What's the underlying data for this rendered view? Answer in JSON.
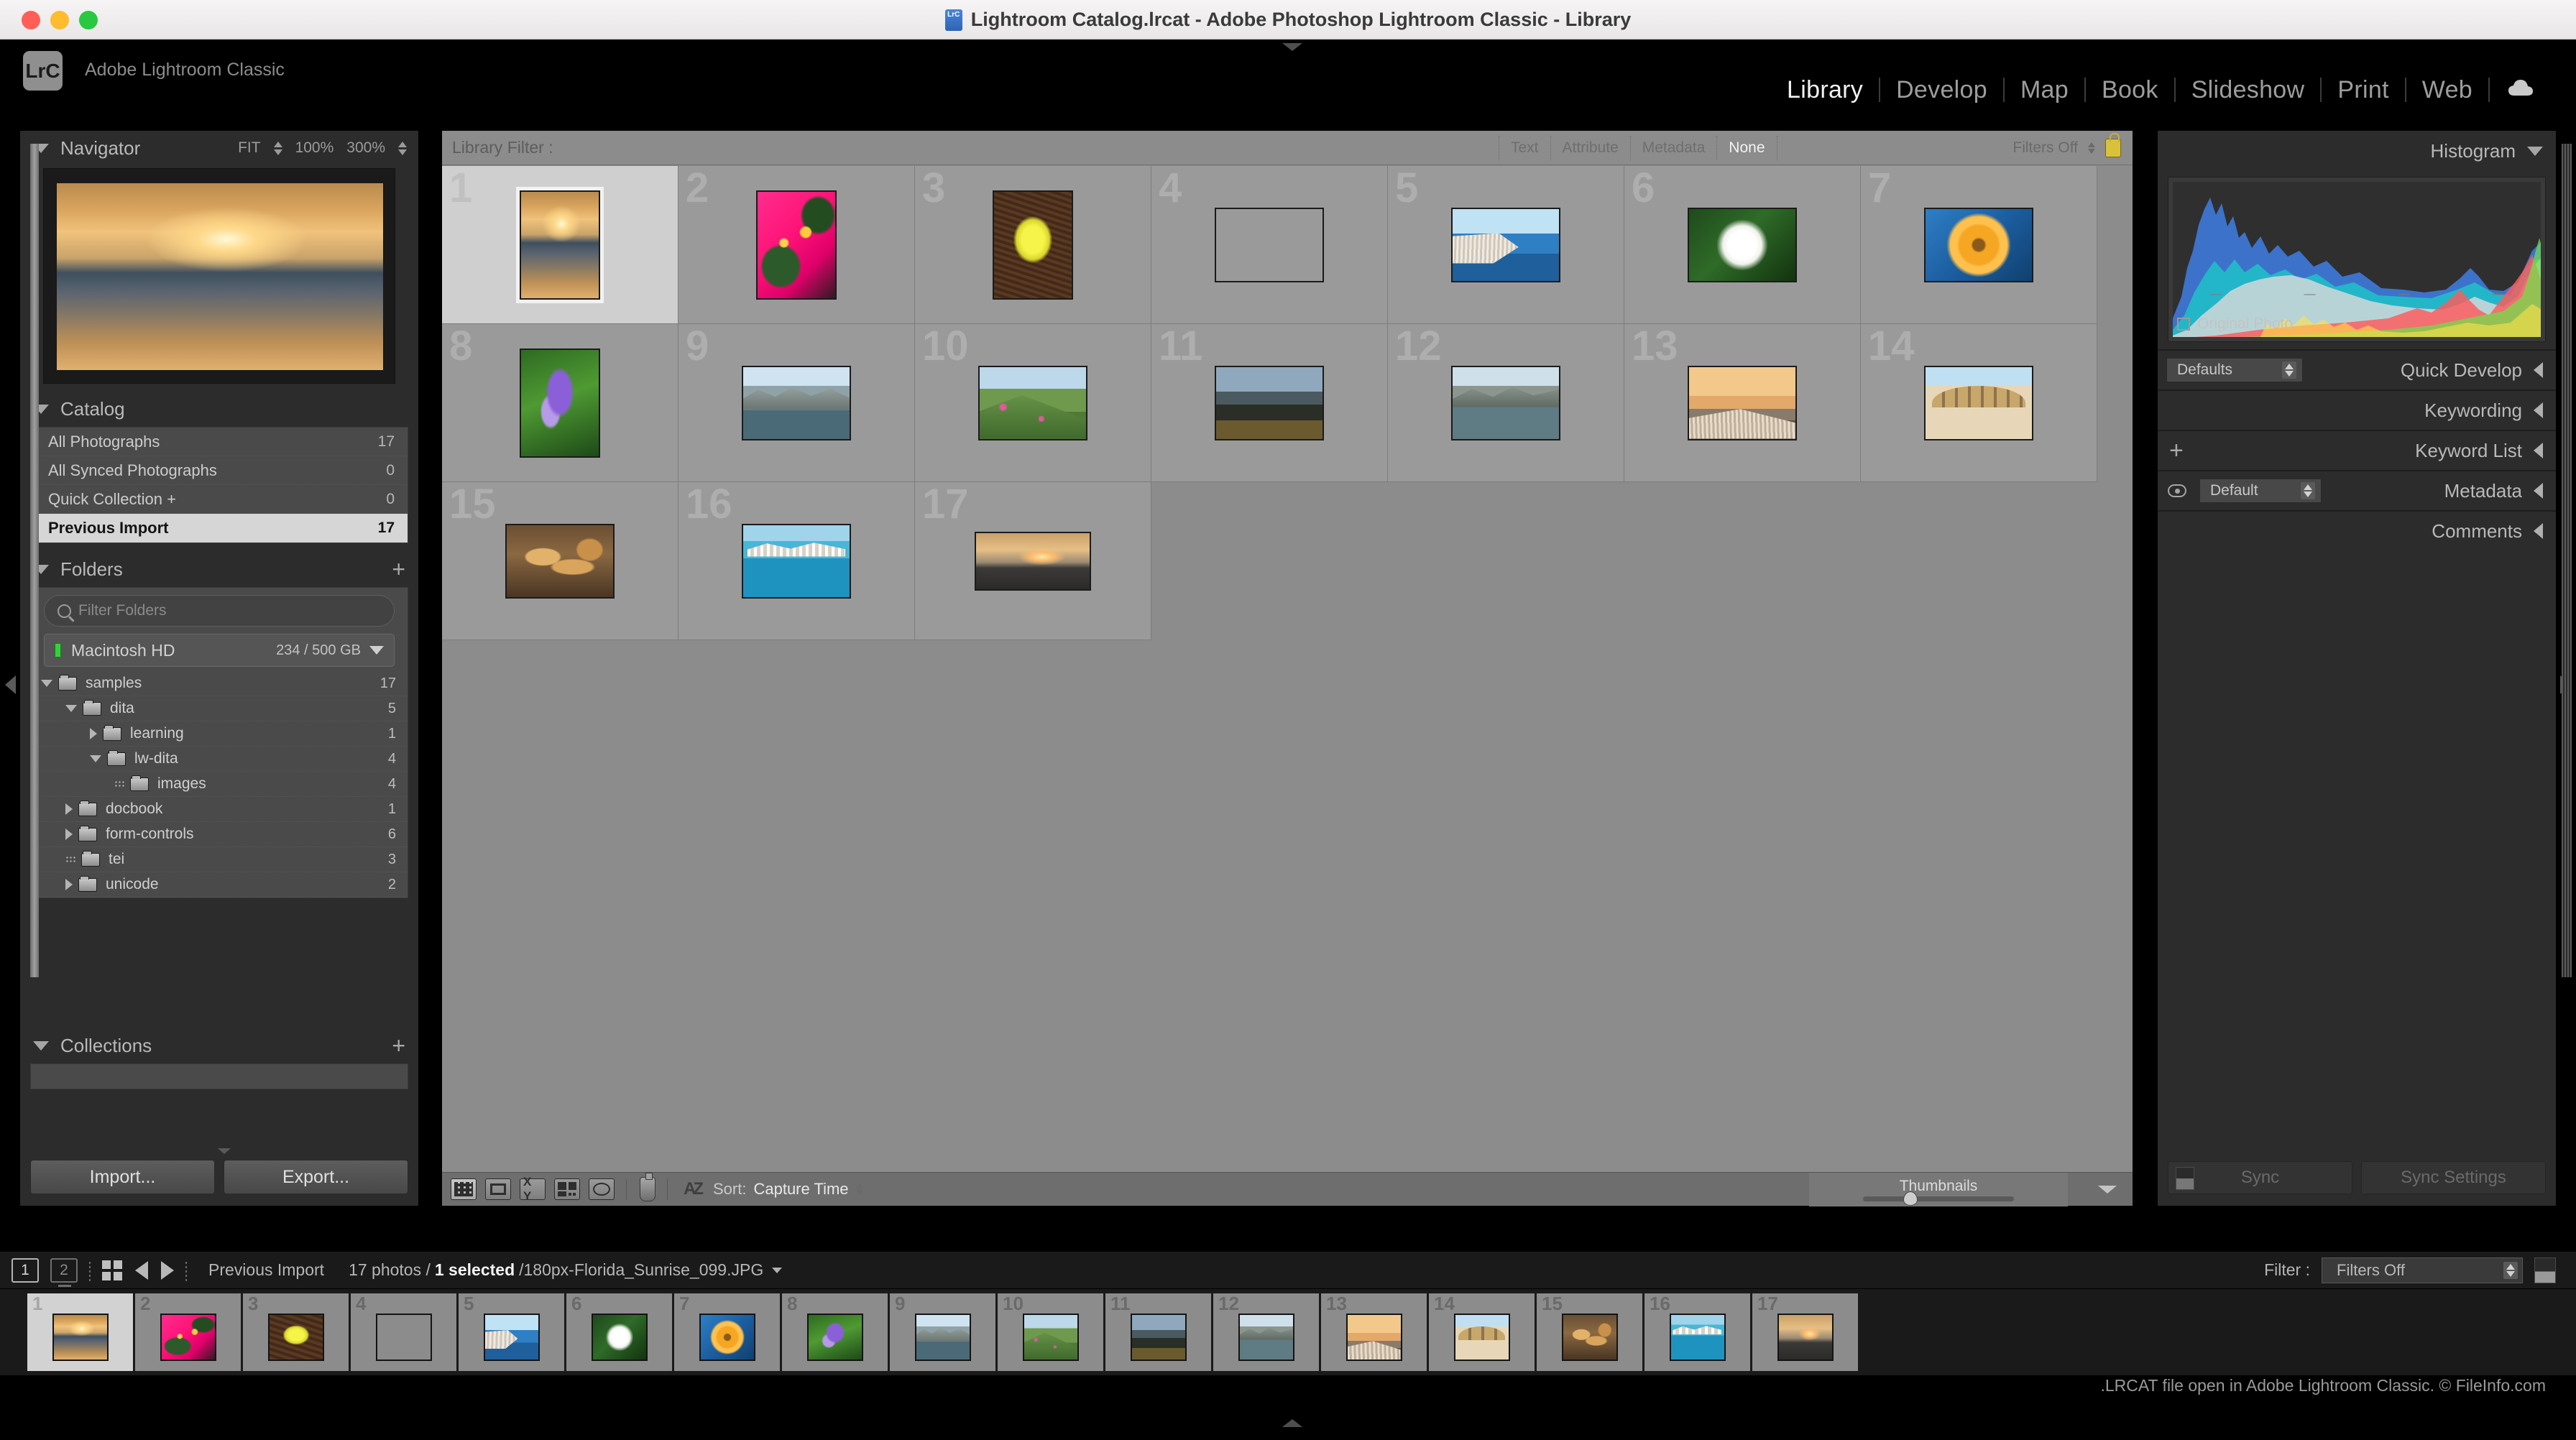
{
  "window": {
    "title": "Lightroom Catalog.lrcat - Adobe Photoshop Lightroom Classic - Library",
    "app_icon": "lrcat-file-icon",
    "traffic_lights": [
      "close",
      "minimize",
      "zoom"
    ]
  },
  "identity": {
    "logo": "LrC",
    "name": "Adobe Lightroom Classic"
  },
  "modules": {
    "items": [
      {
        "label": "Library",
        "active": true
      },
      {
        "label": "Develop",
        "active": false
      },
      {
        "label": "Map",
        "active": false
      },
      {
        "label": "Book",
        "active": false
      },
      {
        "label": "Slideshow",
        "active": false
      },
      {
        "label": "Print",
        "active": false
      },
      {
        "label": "Web",
        "active": false
      }
    ],
    "cloud_icon": "cloud-icon"
  },
  "left_panel": {
    "navigator": {
      "title": "Navigator",
      "zoom_fit": "FIT",
      "zoom_100": "100%",
      "zoom_300": "300%"
    },
    "catalog": {
      "title": "Catalog",
      "items": [
        {
          "label": "All Photographs",
          "count": "17",
          "selected": false
        },
        {
          "label": "All Synced Photographs",
          "count": "0",
          "selected": false
        },
        {
          "label": "Quick Collection +",
          "count": "0",
          "selected": false
        },
        {
          "label": "Previous Import",
          "count": "17",
          "selected": true
        }
      ]
    },
    "folders": {
      "title": "Folders",
      "add_label": "+",
      "filter_placeholder": "Filter Folders",
      "volume": {
        "name": "Macintosh HD",
        "space": "234 / 500 GB"
      },
      "tree": [
        {
          "name": "samples",
          "count": "17",
          "indent": 0,
          "state": "open"
        },
        {
          "name": "dita",
          "count": "5",
          "indent": 1,
          "state": "open"
        },
        {
          "name": "learning",
          "count": "1",
          "indent": 2,
          "state": "closed"
        },
        {
          "name": "lw-dita",
          "count": "4",
          "indent": 2,
          "state": "open"
        },
        {
          "name": "images",
          "count": "4",
          "indent": 3,
          "state": "dots"
        },
        {
          "name": "docbook",
          "count": "1",
          "indent": 1,
          "state": "closed"
        },
        {
          "name": "form-controls",
          "count": "6",
          "indent": 1,
          "state": "closed"
        },
        {
          "name": "tei",
          "count": "3",
          "indent": 1,
          "state": "dots"
        },
        {
          "name": "unicode",
          "count": "2",
          "indent": 1,
          "state": "closed"
        }
      ]
    },
    "collections": {
      "title": "Collections",
      "add_label": "+"
    },
    "import_label": "Import...",
    "export_label": "Export..."
  },
  "library_filter": {
    "label": "Library Filter :",
    "tabs": [
      {
        "label": "Text",
        "active": false
      },
      {
        "label": "Attribute",
        "active": false
      },
      {
        "label": "Metadata",
        "active": false
      },
      {
        "label": "None",
        "active": true
      }
    ],
    "filters_off": "Filters Off",
    "lock_icon": "lock-icon"
  },
  "grid": {
    "cells": [
      {
        "index": "1",
        "selected": true,
        "style": "sunset",
        "orient": "portrait"
      },
      {
        "index": "2",
        "selected": false,
        "style": "pinkflower",
        "orient": "portrait"
      },
      {
        "index": "3",
        "selected": false,
        "style": "yellowmum",
        "orient": "portrait"
      },
      {
        "index": "4",
        "selected": false,
        "style": "bluesky",
        "orient": "landscape"
      },
      {
        "index": "5",
        "selected": false,
        "style": "santorini",
        "orient": "landscape"
      },
      {
        "index": "6",
        "selected": false,
        "style": "whiteflower",
        "orient": "landscape"
      },
      {
        "index": "7",
        "selected": false,
        "style": "gerbera",
        "orient": "landscape"
      },
      {
        "index": "8",
        "selected": false,
        "style": "iris",
        "orient": "portrait"
      },
      {
        "index": "9",
        "selected": false,
        "style": "mountainlake",
        "orient": "landscape"
      },
      {
        "index": "10",
        "selected": false,
        "style": "greenhill",
        "orient": "landscape"
      },
      {
        "index": "11",
        "selected": false,
        "style": "darkfield",
        "orient": "landscape"
      },
      {
        "index": "12",
        "selected": false,
        "style": "rocklake",
        "orient": "landscape"
      },
      {
        "index": "13",
        "selected": false,
        "style": "oiasunset",
        "orient": "landscape"
      },
      {
        "index": "14",
        "selected": false,
        "style": "beachumb",
        "orient": "landscape"
      },
      {
        "index": "15",
        "selected": false,
        "style": "bread",
        "orient": "landscape"
      },
      {
        "index": "16",
        "selected": false,
        "style": "harbor",
        "orient": "landscape"
      },
      {
        "index": "17",
        "selected": false,
        "style": "sunset2",
        "orient": "wide"
      }
    ]
  },
  "toolbar": {
    "views": [
      "grid-view-icon",
      "loupe-view-icon",
      "compare-view-icon",
      "survey-view-icon",
      "people-view-icon"
    ],
    "painter_icon": "spray-can-icon",
    "sort_az_icon": "sort-az-icon",
    "sort_label": "Sort:",
    "sort_value": "Capture Time",
    "thumbnails_label": "Thumbnails"
  },
  "right_panel": {
    "histogram": {
      "title": "Histogram",
      "original_photo": "Original Photo"
    },
    "quick_develop": {
      "title": "Quick Develop",
      "preset": "Defaults"
    },
    "keywording": {
      "title": "Keywording"
    },
    "keyword_list": {
      "title": "Keyword List",
      "add_label": "+"
    },
    "metadata": {
      "title": "Metadata",
      "preset": "Default",
      "eye_icon": "eye-icon"
    },
    "comments": {
      "title": "Comments"
    },
    "sync_label": "Sync",
    "sync_settings_label": "Sync Settings"
  },
  "filmstrip_bar": {
    "monitor1": "1",
    "monitor2": "2",
    "grid_icon": "filmstrip-grid-icon",
    "back_icon": "back-arrow-icon",
    "forward_icon": "forward-arrow-icon",
    "source": "Previous Import",
    "photos_count": "17 photos /",
    "selected_count": "1 selected",
    "filename": "/180px-Florida_Sunrise_099.JPG",
    "filter_label": "Filter :",
    "filter_value": "Filters Off"
  },
  "filmstrip": {
    "cells": [
      {
        "index": "1",
        "selected": true,
        "style": "sunset"
      },
      {
        "index": "2",
        "selected": false,
        "style": "pinkflower"
      },
      {
        "index": "3",
        "selected": false,
        "style": "yellowmum"
      },
      {
        "index": "4",
        "selected": false,
        "style": "bluesky"
      },
      {
        "index": "5",
        "selected": false,
        "style": "santorini"
      },
      {
        "index": "6",
        "selected": false,
        "style": "whiteflower"
      },
      {
        "index": "7",
        "selected": false,
        "style": "gerbera"
      },
      {
        "index": "8",
        "selected": false,
        "style": "iris"
      },
      {
        "index": "9",
        "selected": false,
        "style": "mountainlake"
      },
      {
        "index": "10",
        "selected": false,
        "style": "greenhill"
      },
      {
        "index": "11",
        "selected": false,
        "style": "darkfield"
      },
      {
        "index": "12",
        "selected": false,
        "style": "rocklake"
      },
      {
        "index": "13",
        "selected": false,
        "style": "oiasunset"
      },
      {
        "index": "14",
        "selected": false,
        "style": "beachumb"
      },
      {
        "index": "15",
        "selected": false,
        "style": "bread"
      },
      {
        "index": "16",
        "selected": false,
        "style": "harbor"
      },
      {
        "index": "17",
        "selected": false,
        "style": "sunset2"
      }
    ]
  },
  "watermark": ".LRCAT file open in Adobe Lightroom Classic. © FileInfo.com",
  "colors": {
    "panel_bg": "#2c2c2c",
    "grid_bg": "#8c8c8c",
    "selection": "#d6d6d6",
    "accent_green": "#36d13a",
    "lock_yellow": "#d9c23a"
  }
}
